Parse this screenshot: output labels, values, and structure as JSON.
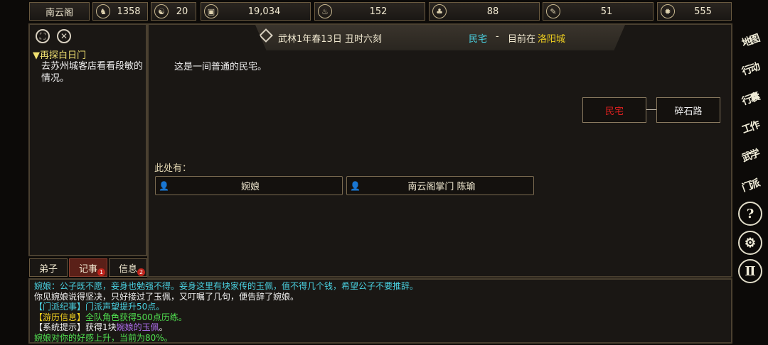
{
  "topbar": {
    "sect_name": "南云阁",
    "stats": [
      {
        "icon": "horse-icon",
        "glyph": "♞",
        "value": "1358"
      },
      {
        "icon": "yinyang-icon",
        "glyph": "☯",
        "value": "20"
      },
      {
        "icon": "coin-icon",
        "glyph": "▣",
        "value": "19,034"
      },
      {
        "icon": "food-bowl-icon",
        "glyph": "♨",
        "value": "152"
      },
      {
        "icon": "herb-icon",
        "glyph": "♣",
        "value": "88"
      },
      {
        "icon": "scroll-icon",
        "glyph": "✎",
        "value": "51"
      },
      {
        "icon": "beast-icon",
        "glyph": "✹",
        "value": "555"
      }
    ]
  },
  "quest": {
    "title": "▼再探白日门",
    "desc": "去苏州城客店看看段敏的情况。"
  },
  "tabs": [
    {
      "label": "弟子",
      "badge": ""
    },
    {
      "label": "记事",
      "badge": "1"
    },
    {
      "label": "信息",
      "badge": "2"
    }
  ],
  "header": {
    "date": "武林1年春13日 丑时六刻",
    "location_name": "民宅",
    "separator": "-",
    "current_prefix": "目前在",
    "city": "洛阳城"
  },
  "room_desc": "这是一间普通的民宅。",
  "map": {
    "current_room": "民宅",
    "adjacent_room": "碎石路"
  },
  "here_label": "此处有：",
  "npcs": [
    {
      "name": "婉娘"
    },
    {
      "name": "南云阁掌门 陈瑜"
    }
  ],
  "side_menu": [
    "地图",
    "行动",
    "行囊",
    "工作",
    "武学",
    "门派",
    "?",
    "⚙",
    "Ⅱ"
  ],
  "log": [
    {
      "segments": [
        {
          "text": "婉娘：公子既不愿，妾身也勉强不得。妾身这里有块家传的玉佩，值不得几个钱，希望公子不要推辞。",
          "color": "#4ad0e0"
        }
      ]
    },
    {
      "segments": [
        {
          "text": "你见婉娘说得坚决，只好接过了玉佩，又叮嘱了几句，便告辞了婉娘。",
          "color": "#f0f0f0"
        }
      ]
    },
    {
      "segments": [
        {
          "text": "【门派纪事】",
          "color": "#4ad0e0"
        },
        {
          "text": "门派声望提升50点。",
          "color": "#4ad0e0"
        }
      ]
    },
    {
      "segments": [
        {
          "text": "【游历信息】",
          "color": "#f0d020"
        },
        {
          "text": "全队角色获得500点历练。",
          "color": "#50e050"
        }
      ]
    },
    {
      "segments": [
        {
          "text": "【系统提示】",
          "color": "#f0f0f0"
        },
        {
          "text": "获得1块",
          "color": "#f0f0f0"
        },
        {
          "text": "婉娘的玉佩",
          "color": "#b070f0"
        },
        {
          "text": "。",
          "color": "#f0f0f0"
        }
      ]
    },
    {
      "segments": [
        {
          "text": "婉娘对你的好感上升，当前为80%。",
          "color": "#50e050"
        }
      ]
    }
  ],
  "colors": {
    "location_green": "#4ad0e0",
    "city_yellow": "#f0d020",
    "current_room_red": "#e02020"
  }
}
